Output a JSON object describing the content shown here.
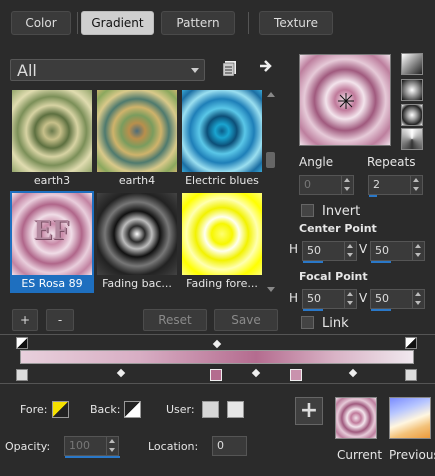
{
  "tabs": [
    {
      "label": "Color",
      "active": false
    },
    {
      "label": "Gradient",
      "active": true
    },
    {
      "label": "Pattern",
      "active": false
    },
    {
      "label": "Texture",
      "active": false
    }
  ],
  "category": {
    "value": "All"
  },
  "gallery": [
    {
      "name": "earth3",
      "selected": false
    },
    {
      "name": "earth4",
      "selected": false
    },
    {
      "name": "Electric blues",
      "selected": false
    },
    {
      "name": "ES Rosa 89",
      "selected": true
    },
    {
      "name": "Fading bac...",
      "selected": false
    },
    {
      "name": "Fading fore...",
      "selected": false
    }
  ],
  "thumb_text": "EF",
  "buttons": {
    "add": "+",
    "remove": "-",
    "reset": "Reset",
    "save": "Save"
  },
  "angle": {
    "label": "Angle",
    "value": "0"
  },
  "repeats": {
    "label": "Repeats",
    "value": "2"
  },
  "invert": {
    "label": "Invert",
    "checked": false
  },
  "center_point": {
    "label": "Center Point",
    "h_label": "H",
    "h": "50",
    "v_label": "V",
    "v": "50"
  },
  "focal_point": {
    "label": "Focal Point",
    "h_label": "H",
    "h": "50",
    "v_label": "V",
    "v": "50"
  },
  "link": {
    "label": "Link",
    "checked": false
  },
  "gradient_editor": {
    "stops": [
      "#e8d0dc",
      "#b46c8f",
      "#f0e8ee"
    ]
  },
  "bottom": {
    "fore_label": "Fore:",
    "back_label": "Back:",
    "user_label": "User:",
    "opacity_label": "Opacity:",
    "opacity_value": "100",
    "location_label": "Location:",
    "location_value": "0",
    "current_label": "Current",
    "previous_label": "Previous"
  },
  "colors": {
    "accent": "#2a78c8",
    "selection": "#1e6fbf",
    "fore": "#f5e100"
  }
}
